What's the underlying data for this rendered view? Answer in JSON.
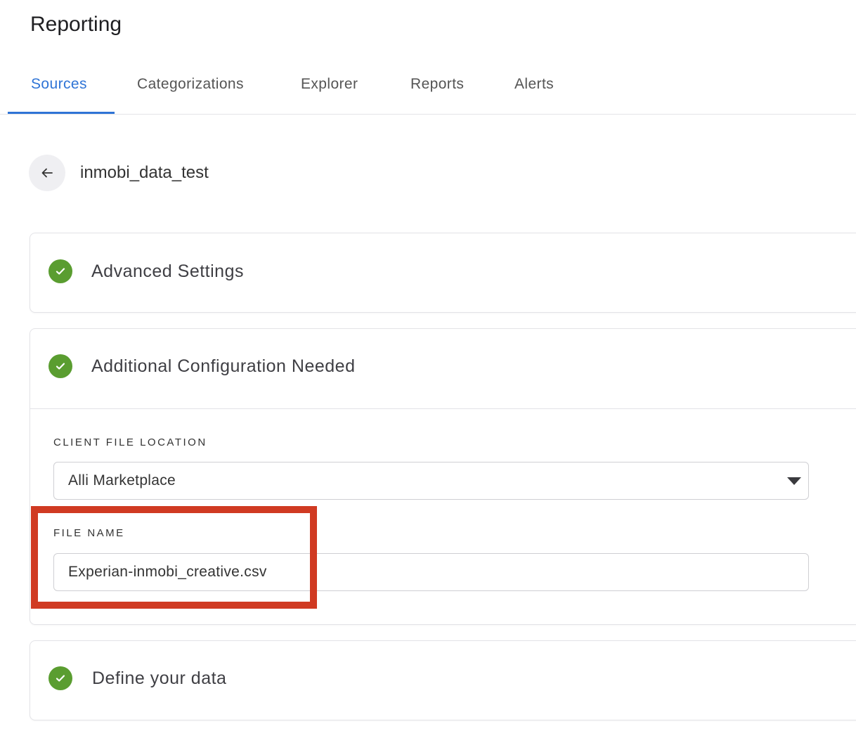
{
  "header": {
    "title": "Reporting"
  },
  "tabs": [
    {
      "label": "Sources",
      "active": true
    },
    {
      "label": "Categorizations"
    },
    {
      "label": "Explorer"
    },
    {
      "label": "Reports"
    },
    {
      "label": "Alerts"
    }
  ],
  "source": {
    "name": "inmobi_data_test",
    "back_icon": "arrow-left-icon"
  },
  "sections": [
    {
      "title": "Advanced Settings",
      "status": "complete"
    },
    {
      "title": "Additional Configuration Needed",
      "status": "complete",
      "fields": {
        "client_file_location": {
          "label": "CLIENT FILE LOCATION",
          "value": "Alli Marketplace"
        },
        "file_name": {
          "label": "FILE NAME",
          "value": "Experian-inmobi_creative.csv"
        }
      }
    },
    {
      "title": "Define your data",
      "status": "complete"
    }
  ],
  "colors": {
    "accent": "#2f74d6",
    "success": "#5a9d30",
    "highlight": "#d03a22"
  }
}
